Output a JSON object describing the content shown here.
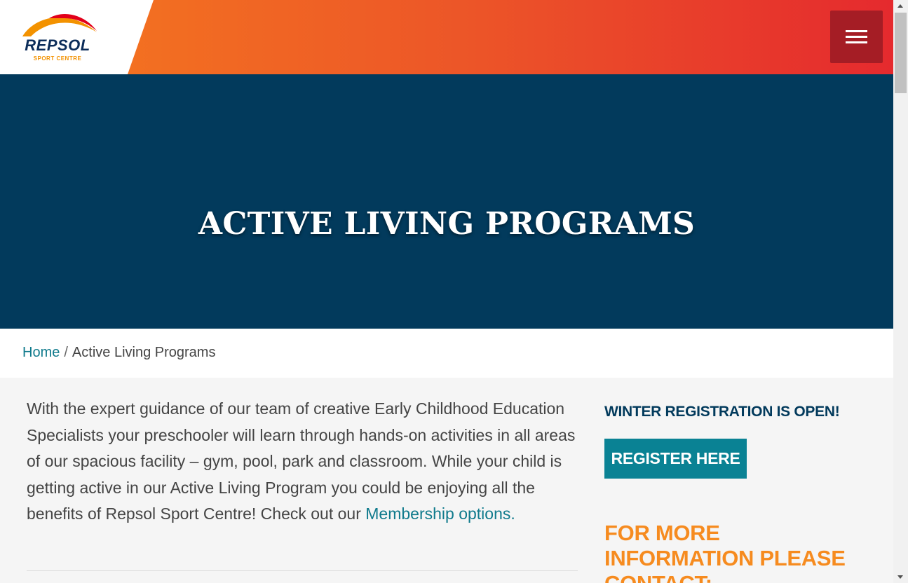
{
  "header": {
    "logo_text": "REPSOL",
    "logo_subtext": "SPORT CENTRE",
    "menu_icon": "hamburger-menu-icon"
  },
  "hero": {
    "title": "ACTIVE LIVING PROGRAMS"
  },
  "breadcrumb": {
    "home": "Home",
    "separator": "/",
    "current": "Active Living Programs"
  },
  "main": {
    "intro_text": "With the expert guidance of our team of creative Early Childhood Education Specialists your preschooler will learn through hands-on activities in all areas of our spacious facility – gym, pool, park and classroom. While your child is getting active in our Active Living Program you could be enjoying all the benefits of Repsol Sport Centre! Check out our ",
    "intro_link": "Membership options."
  },
  "sidebar": {
    "registration_label": "WINTER REGISTRATION IS OPEN!",
    "register_button": "REGISTER HERE",
    "more_info_heading": "FOR MORE INFORMATION PLEASE CONTACT:"
  },
  "colors": {
    "navy": "#023a5c",
    "teal": "#0a8294",
    "orange": "#f68b1f",
    "menu_red": "#a51d25"
  }
}
